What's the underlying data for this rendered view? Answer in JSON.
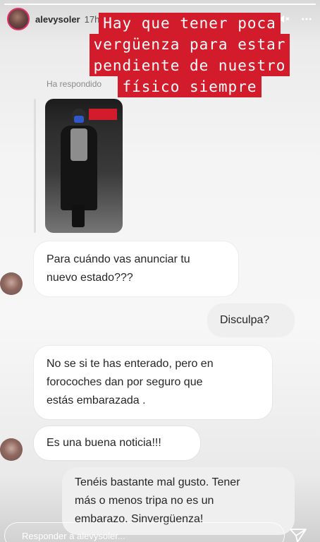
{
  "story": {
    "username": "alevysoler",
    "time": "17h",
    "progress": 1.0,
    "caption_lines": [
      "Hay que tener poca",
      "vergüenza para estar",
      "pendiente de nuestro",
      "físico siempre"
    ],
    "caption_color": "#d21b2b"
  },
  "thread": {
    "replied_label": "Ha respondido",
    "messages": [
      {
        "from": "other",
        "text_lines": [
          "Para cuándo vas anunciar tu",
          "nuevo estado???"
        ]
      },
      {
        "from": "self",
        "text_lines": [
          "Disculpa?"
        ]
      },
      {
        "from": "other",
        "text_lines": [
          "No  se si te has enterado, pero en",
          "forocoches dan por seguro que",
          "estás embarazada ."
        ]
      },
      {
        "from": "other",
        "text_lines": [
          "Es una buena noticia!!!"
        ]
      },
      {
        "from": "self",
        "text_lines": [
          "Tenéis bastante mal gusto. Tener",
          "más o menos tripa no es un",
          "embarazo. Sinvergüenza!"
        ]
      }
    ]
  },
  "footer": {
    "reply_placeholder": "Responder a alevysoler..."
  },
  "icons": {
    "play": "play-icon",
    "volume": "volume-mute-icon",
    "more": "more-icon",
    "send": "send-icon"
  }
}
